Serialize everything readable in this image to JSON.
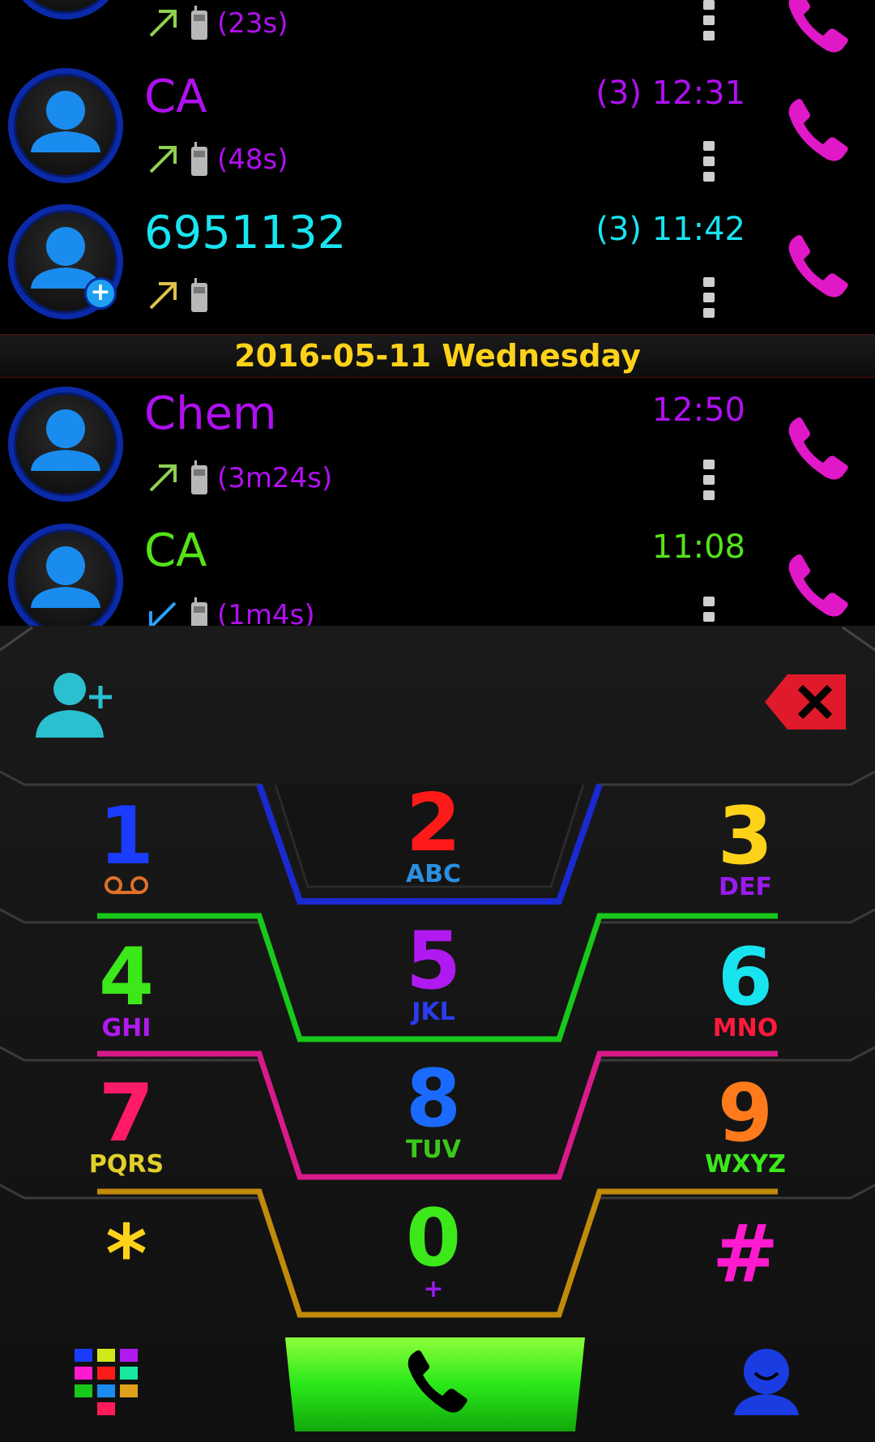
{
  "call_log": {
    "entries": [
      {
        "name": "",
        "time": "",
        "duration": "(23s)",
        "name_color": "#b010f0",
        "time_color": "#b010f0",
        "dur_color": "#b010f0",
        "direction": "outgoing",
        "arrow_color": "#8fd14f"
      },
      {
        "name": "CA",
        "time": "(3) 12:31",
        "duration": "(48s)",
        "name_color": "#b010f0",
        "time_color": "#b010f0",
        "dur_color": "#b010f0",
        "direction": "outgoing",
        "arrow_color": "#8fd14f"
      },
      {
        "name": "6951132",
        "time": "(3) 11:42",
        "duration": "",
        "name_color": "#18e4f0",
        "time_color": "#18e4f0",
        "dur_color": "#18e4f0",
        "direction": "outgoing",
        "arrow_color": "#e0c24a",
        "add_badge": "+"
      },
      {
        "name": "Chem",
        "time": "12:50",
        "duration": "(3m24s)",
        "name_color": "#b010f0",
        "time_color": "#b010f0",
        "dur_color": "#b010f0",
        "direction": "outgoing",
        "arrow_color": "#8fd14f"
      },
      {
        "name": "CA",
        "time": "11:08",
        "duration": "(1m4s)",
        "name_color": "#55e31a",
        "time_color": "#55e31a",
        "dur_color": "#b010f0",
        "direction": "incoming",
        "arrow_color": "#2aa0ff"
      }
    ],
    "date_header": "2016-05-11  Wednesday"
  },
  "dialer": {
    "keys": [
      {
        "digit": "1",
        "letters": "oo",
        "digit_color": "#1a3cff",
        "letter_color": "#e0702a"
      },
      {
        "digit": "2",
        "letters": "ABC",
        "digit_color": "#ff1a1a",
        "letter_color": "#2a8fe0"
      },
      {
        "digit": "3",
        "letters": "DEF",
        "digit_color": "#ffd21a",
        "letter_color": "#9a1af0"
      },
      {
        "digit": "4",
        "letters": "GHI",
        "digit_color": "#3ce81a",
        "letter_color": "#b01af0"
      },
      {
        "digit": "5",
        "letters": "JKL",
        "digit_color": "#b01af0",
        "letter_color": "#2a3cf0"
      },
      {
        "digit": "6",
        "letters": "MNO",
        "digit_color": "#18e4f0",
        "letter_color": "#ff1a3c"
      },
      {
        "digit": "7",
        "letters": "PQRS",
        "digit_color": "#ff1a6a",
        "letter_color": "#e0d02a"
      },
      {
        "digit": "8",
        "letters": "TUV",
        "digit_color": "#1a6aff",
        "letter_color": "#3cc81a"
      },
      {
        "digit": "9",
        "letters": "WXYZ",
        "digit_color": "#ff7a1a",
        "letter_color": "#3ce81a"
      },
      {
        "digit": "*",
        "letters": "",
        "digit_color": "#ffd21a",
        "letter_color": "#ffd21a"
      },
      {
        "digit": "0",
        "letters": "+",
        "digit_color": "#3ce81a",
        "letter_color": "#9a1af0"
      },
      {
        "digit": "#",
        "letters": "",
        "digit_color": "#ff1ad0",
        "letter_color": "#ff1ad0"
      }
    ],
    "icons": {
      "add_contact": "add-contact-icon",
      "backspace": "backspace-icon",
      "call": "phone-icon",
      "apps": "apps-grid-icon",
      "contacts": "contacts-icon"
    }
  }
}
